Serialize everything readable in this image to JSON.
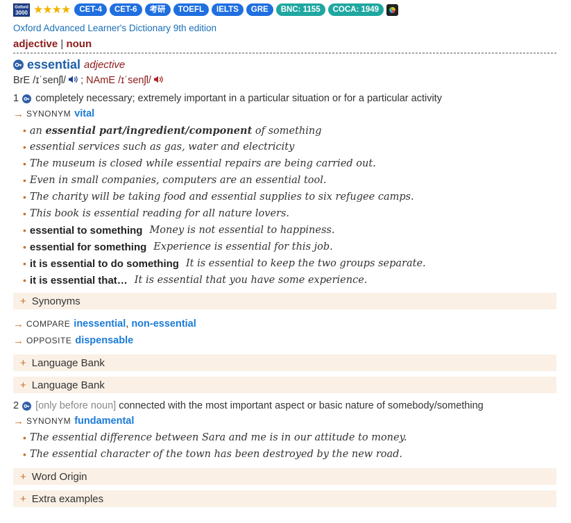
{
  "badges": {
    "logo_text": [
      "Oxford",
      "3000"
    ],
    "stars": "★★★★",
    "items": [
      "CET-4",
      "CET-6",
      "考研",
      "TOEFL",
      "IELTS",
      "GRE"
    ],
    "freq": [
      "BNC: 1155",
      "COCA: 1949"
    ]
  },
  "dictionary_name": "Oxford Advanced Learner's Dictionary 9th edition",
  "pos_nav": {
    "first": "adjective",
    "sep": "|",
    "second": "noun"
  },
  "headword": {
    "word": "essential",
    "pos": "adjective"
  },
  "pronunciation": {
    "bre_label": "BrE",
    "bre_ipa": "/ɪˈsenʃl/",
    "separator": ";",
    "name_label": "NAmE",
    "name_ipa": "/ɪˈsenʃl/"
  },
  "sense1": {
    "num": "1",
    "definition": "completely necessary; extremely important in a particular situation or for a particular activity",
    "synonym": {
      "type": "SYNONYM",
      "word": "vital"
    },
    "examples": [
      {
        "pre": "an ",
        "bold": "essential part/ingredient/component",
        "post": " of something"
      },
      {
        "text": "essential services such as gas, water and electricity"
      },
      {
        "text": "The museum is closed while essential repairs are being carried out."
      },
      {
        "text": "Even in small companies, computers are an essential tool."
      },
      {
        "text": "The charity will be taking food and essential supplies to six refugee camps."
      },
      {
        "text": "This book is essential reading for all nature lovers."
      }
    ],
    "patterns": [
      {
        "cf": "essential to something",
        "ex": "Money is not essential to happiness."
      },
      {
        "cf": "essential for something",
        "ex": "Experience is essential for this job."
      },
      {
        "cf": "it is essential to do something",
        "ex": "It is essential to keep the two groups separate."
      },
      {
        "cf": "it is essential that…",
        "ex": "It is essential that you have some experience."
      }
    ],
    "synonyms_panel": "Synonyms",
    "compare": {
      "type": "COMPARE",
      "word1": "inessential",
      "comma": ",",
      "word2": "non-essential"
    },
    "opposite": {
      "type": "OPPOSITE",
      "word": "dispensable"
    },
    "panels": [
      "Language Bank",
      "Language Bank"
    ]
  },
  "sense2": {
    "num": "2",
    "grammar": "[only before noun]",
    "definition": "connected with the most important aspect or basic nature of somebody/something",
    "synonym": {
      "type": "SYNONYM",
      "word": "fundamental"
    },
    "examples": [
      "The essential difference between Sara and me is in our attitude to money.",
      "The essential character of the town has been destroyed by the new road."
    ]
  },
  "bottom_panels": [
    "Word Origin",
    "Extra examples"
  ],
  "glyphs": {
    "arrow": "→",
    "bullet": "•",
    "plus": "+"
  },
  "colors": {
    "headword": "#1f5fa8",
    "pos": "#8b1a1a",
    "link": "#1a7bd8",
    "accent": "#c8702a",
    "panel_bg": "#faf0e6"
  }
}
